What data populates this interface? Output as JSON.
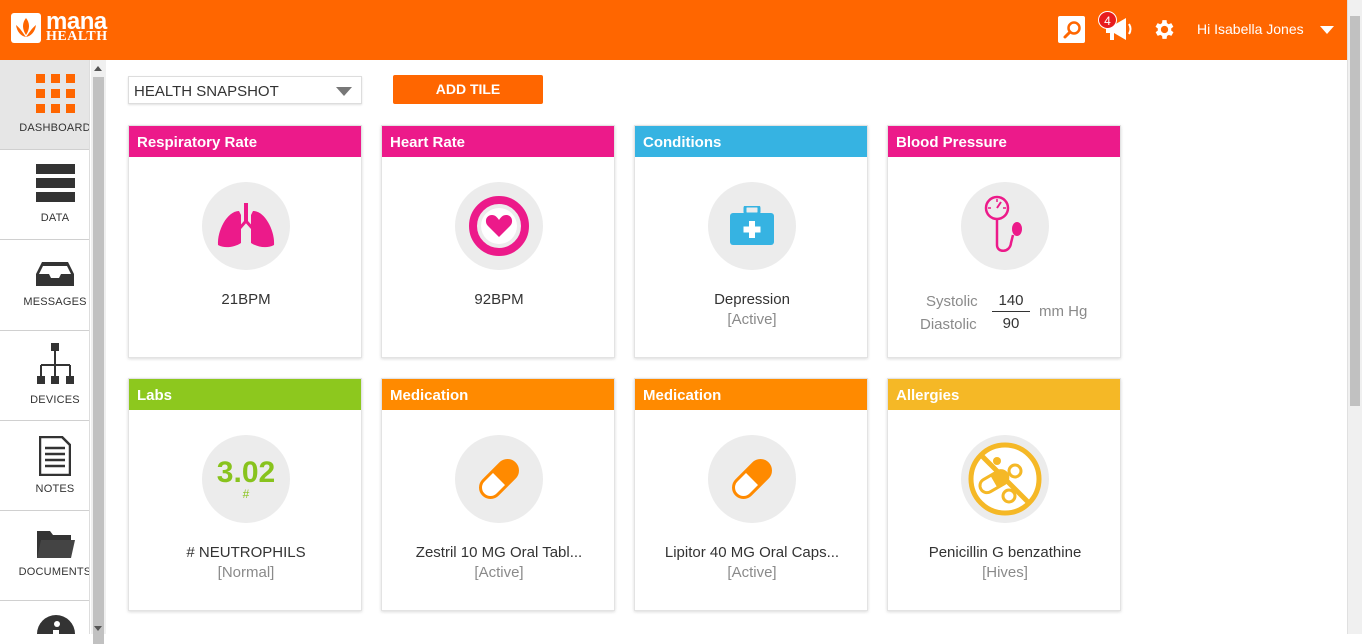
{
  "app": {
    "logo_line1": "mana",
    "logo_line2": "HEALTH",
    "notification_count": "4",
    "user_greeting": "Hi Isabella Jones",
    "brand_color": "#ff6600"
  },
  "sidebar": {
    "items": [
      {
        "label": "DASHBOARD",
        "icon": "grid-icon",
        "active": true
      },
      {
        "label": "DATA",
        "icon": "bars-icon",
        "active": false
      },
      {
        "label": "MESSAGES",
        "icon": "inbox-tray-icon",
        "active": false
      },
      {
        "label": "DEVICES",
        "icon": "network-tree-icon",
        "active": false
      },
      {
        "label": "NOTES",
        "icon": "document-icon",
        "active": false
      },
      {
        "label": "DOCUMENTS",
        "icon": "folder-icon",
        "active": false
      },
      {
        "label": "",
        "icon": "info-icon",
        "active": false
      }
    ]
  },
  "toolbar": {
    "snapshot_select_value": "HEALTH SNAPSHOT",
    "add_tile_label": "ADD TILE"
  },
  "tiles": [
    {
      "title": "Respiratory Rate",
      "color": "#ec1a8a",
      "icon": "lungs-icon",
      "value": "21BPM",
      "sub": ""
    },
    {
      "title": "Heart Rate",
      "color": "#ec1a8a",
      "icon": "heart-icon",
      "value": "92BPM",
      "sub": ""
    },
    {
      "title": "Conditions",
      "color": "#36b3e2",
      "icon": "first-aid-kit-icon",
      "value": "Depression",
      "sub": "[Active]"
    },
    {
      "title": "Blood Pressure",
      "color": "#ec1a8a",
      "icon": "blood-pressure-cuff-icon",
      "systolic_label": "Systolic",
      "diastolic_label": "Diastolic",
      "systolic": "140",
      "diastolic": "90",
      "unit": "mm Hg"
    },
    {
      "title": "Labs",
      "color": "#8dc81e",
      "icon": "lab-value",
      "lab_value": "3.02",
      "lab_unit": "#",
      "value": "# NEUTROPHILS",
      "sub": "[Normal]"
    },
    {
      "title": "Medication",
      "color": "#ff8a00",
      "icon": "pill-capsule-icon",
      "value": "Zestril 10 MG Oral Tabl...",
      "sub": "[Active]"
    },
    {
      "title": "Medication",
      "color": "#ff8a00",
      "icon": "pill-capsule-icon",
      "value": "Lipitor 40 MG Oral Caps...",
      "sub": "[Active]"
    },
    {
      "title": "Allergies",
      "color": "#f5b826",
      "icon": "no-pills-icon",
      "value": "Penicillin G benzathine",
      "sub": "[Hives]"
    }
  ]
}
